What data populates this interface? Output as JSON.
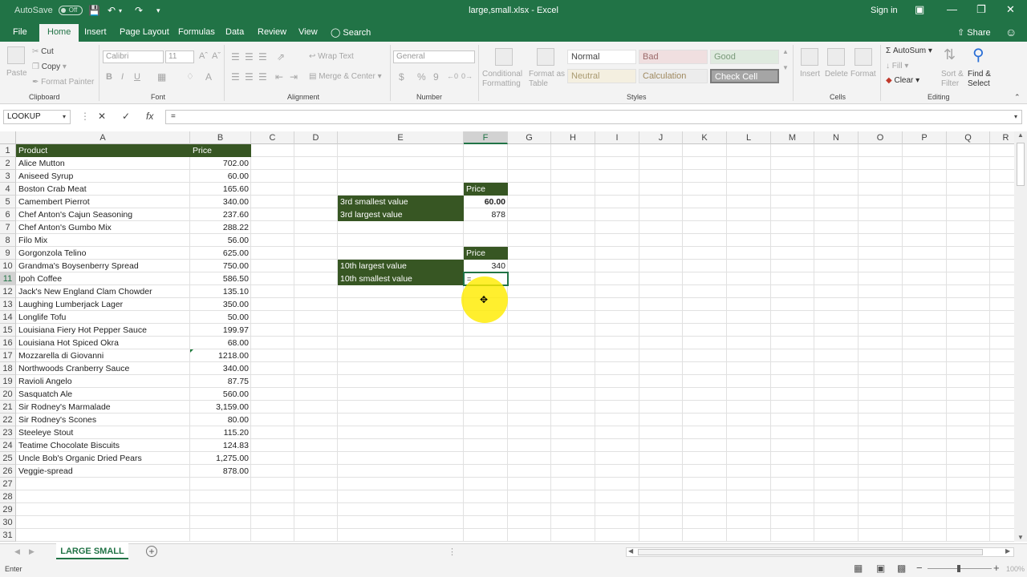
{
  "window": {
    "autosave_label": "AutoSave",
    "autosave_state": "Off",
    "doc_title": "large,small.xlsx  -  Excel",
    "signin": "Sign in"
  },
  "menu": {
    "tabs": [
      "File",
      "Home",
      "Insert",
      "Page Layout",
      "Formulas",
      "Data",
      "Review",
      "View"
    ],
    "search": "Search",
    "share": "Share"
  },
  "ribbon": {
    "clipboard": {
      "paste": "Paste",
      "cut": "Cut",
      "copy": "Copy",
      "format_painter": "Format Painter",
      "label": "Clipboard"
    },
    "font": {
      "name": "Calibri",
      "size": "11",
      "bold": "B",
      "italic": "I",
      "underline": "U",
      "label": "Font"
    },
    "alignment": {
      "wrap": "Wrap Text",
      "merge": "Merge & Center",
      "label": "Alignment"
    },
    "number": {
      "format": "General",
      "currency": "$",
      "percent": "%",
      "comma": "9",
      "label": "Number"
    },
    "styles": {
      "conditional": "Conditional Formatting",
      "format_as_table": "Format as Table",
      "cells": [
        "Normal",
        "Bad",
        "Good",
        "Neutral",
        "Calculation",
        "Check Cell"
      ],
      "label": "Styles"
    },
    "cells": {
      "insert": "Insert",
      "delete": "Delete",
      "format": "Format",
      "label": "Cells"
    },
    "editing": {
      "autosum": "AutoSum",
      "fill": "Fill",
      "clear": "Clear",
      "sort": "Sort & Filter",
      "find": "Find & Select",
      "label": "Editing"
    }
  },
  "formula_bar": {
    "name_box": "LOOKUP",
    "formula": "="
  },
  "columns": [
    "A",
    "B",
    "C",
    "D",
    "E",
    "F",
    "G",
    "H",
    "I",
    "J",
    "K",
    "L",
    "M",
    "N",
    "O",
    "P",
    "Q",
    "R"
  ],
  "rows": [
    "1",
    "2",
    "3",
    "4",
    "5",
    "6",
    "7",
    "8",
    "9",
    "10",
    "11",
    "12",
    "13",
    "14",
    "15",
    "16",
    "17",
    "18",
    "19",
    "20",
    "21",
    "22",
    "23",
    "24",
    "25",
    "26",
    "27",
    "28",
    "29",
    "30",
    "31"
  ],
  "table": {
    "headers": [
      "Product",
      "Price"
    ],
    "rows": [
      [
        "Alice Mutton",
        "702.00"
      ],
      [
        "Aniseed Syrup",
        "60.00"
      ],
      [
        "Boston Crab Meat",
        "165.60"
      ],
      [
        "Camembert Pierrot",
        "340.00"
      ],
      [
        "Chef Anton's Cajun Seasoning",
        "237.60"
      ],
      [
        "Chef Anton's Gumbo Mix",
        "288.22"
      ],
      [
        "Filo Mix",
        "56.00"
      ],
      [
        "Gorgonzola Telino",
        "625.00"
      ],
      [
        "Grandma's Boysenberry Spread",
        "750.00"
      ],
      [
        "Ipoh Coffee",
        "586.50"
      ],
      [
        "Jack's New England Clam Chowder",
        "135.10"
      ],
      [
        "Laughing Lumberjack Lager",
        "350.00"
      ],
      [
        "Longlife Tofu",
        "50.00"
      ],
      [
        "Louisiana Fiery Hot Pepper Sauce",
        "199.97"
      ],
      [
        "Louisiana Hot Spiced Okra",
        "68.00"
      ],
      [
        "Mozzarella di Giovanni",
        "1218.00"
      ],
      [
        "Northwoods Cranberry Sauce",
        "340.00"
      ],
      [
        "Ravioli Angelo",
        "87.75"
      ],
      [
        "Sasquatch Ale",
        "560.00"
      ],
      [
        "Sir Rodney's Marmalade",
        "3,159.00"
      ],
      [
        "Sir Rodney's Scones",
        "80.00"
      ],
      [
        "Steeleye Stout",
        "115.20"
      ],
      [
        "Teatime Chocolate Biscuits",
        "124.83"
      ],
      [
        "Uncle Bob's Organic Dried Pears",
        "1,275.00"
      ],
      [
        "Veggie-spread",
        "878.00"
      ]
    ]
  },
  "summary": {
    "price_header_1": "Price",
    "third_smallest_label": "3rd smallest value",
    "third_smallest_value": "60.00",
    "third_largest_label": "3rd largest value",
    "third_largest_value": "878",
    "price_header_2": "Price",
    "tenth_largest_label": "10th largest value",
    "tenth_largest_value": "340",
    "tenth_smallest_label": "10th smallest value",
    "tenth_smallest_value": "="
  },
  "sheet": {
    "tab": "LARGE SMALL"
  },
  "status": {
    "mode": "Enter",
    "zoom": "100%"
  }
}
